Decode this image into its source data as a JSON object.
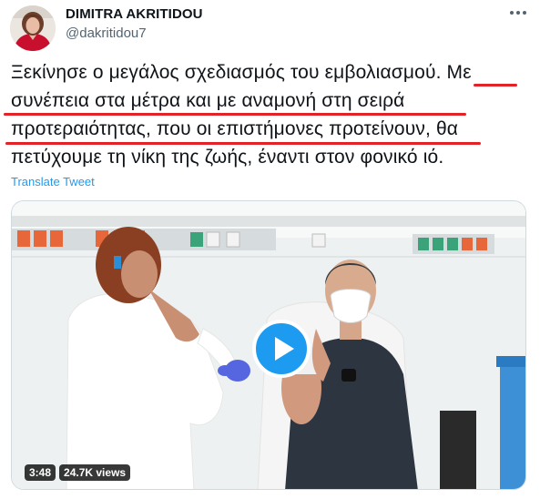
{
  "author": {
    "display_name": "DIMITRA AKRITIDOU",
    "handle": "@dakritidou7",
    "avatar_icon": "user-avatar"
  },
  "tweet": {
    "lines": [
      "Ξεκίνησε ο μεγάλος σχεδιασμός του εμβολιασμού. Με",
      "συνέπεια στα μέτρα και με αναμονή στη σειρά",
      "προτεραιότητας, που οι επιστήμονες προτείνουν, θα",
      "πετύχουμε τη νίκη της ζωής, έναντι στον φονικό ιό."
    ],
    "translate_label": "Translate Tweet",
    "highlight_color": "#e32227"
  },
  "video": {
    "duration": "3:48",
    "views": "24.7K views",
    "play_icon": "play-icon",
    "accent_color": "#1d9bf0"
  },
  "menu_icon": "more-options-icon"
}
